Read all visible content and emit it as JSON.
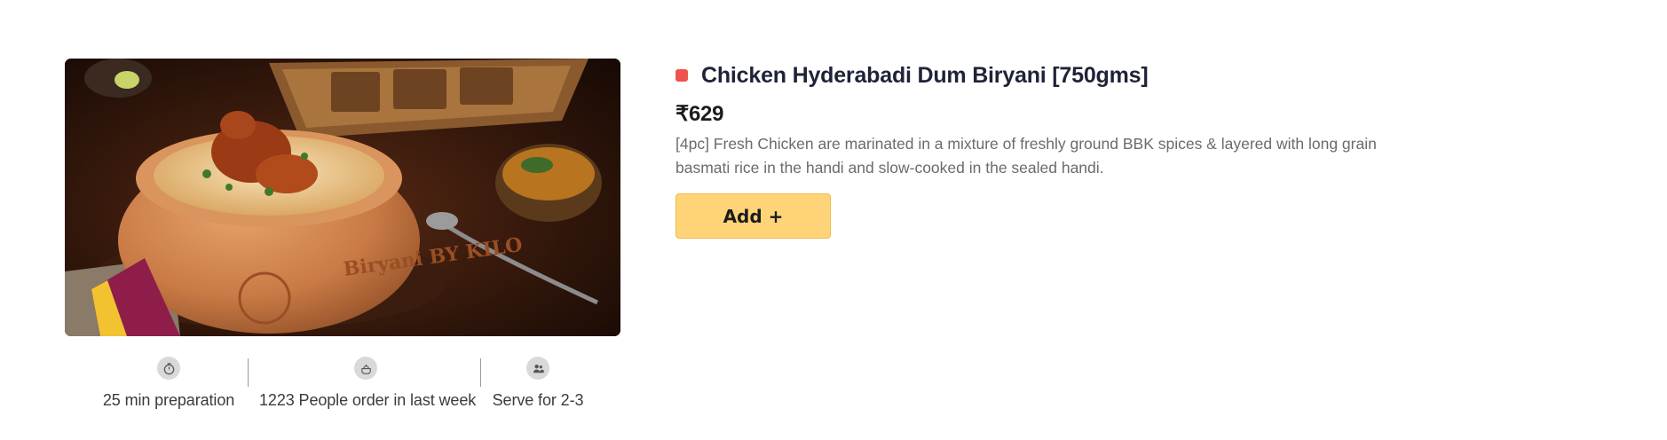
{
  "product": {
    "image_alt": "Chicken Hyderabadi Dum Biryani in clay handi",
    "image_text": "Biryani BY KILO",
    "veg_marker_color": "#ef5350",
    "title": "Chicken Hyderabadi Dum Biryani [750gms]",
    "price": "₹629",
    "description": "[4pc] Fresh Chicken are marinated in a mixture of freshly ground BBK spices & layered with long grain basmati rice in the handi and slow-cooked in the sealed handi.",
    "add_button_label": "Add +"
  },
  "meta": [
    {
      "icon": "stopwatch-icon",
      "label": "25 min preparation"
    },
    {
      "icon": "cooking-pot-icon",
      "label": "1223 People order in last week"
    },
    {
      "icon": "people-icon",
      "label": "Serve for 2-3"
    }
  ],
  "colors": {
    "accent_button": "#ffd479",
    "accent_button_border": "#f0b94a",
    "title_text": "#1f2337",
    "description_text": "#6b6b6b"
  }
}
